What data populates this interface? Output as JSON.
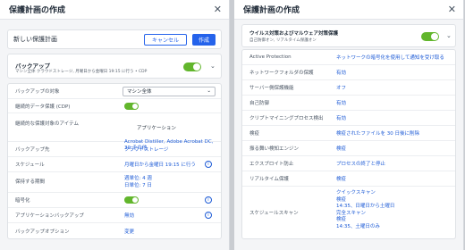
{
  "left": {
    "title": "保護計画の作成",
    "plan_name": "新しい保護計画",
    "cancel_label": "キャンセル",
    "create_label": "作成",
    "backup": {
      "title": "バックアップ",
      "desc": "マシン全体 クラウドストレージ, 月曜日から金曜日 19:15 に行う • CDP"
    },
    "rows": [
      {
        "label": "バックアップの対象",
        "value": "マシン全体",
        "kind": "select"
      },
      {
        "label": "継続的データ保護 (CDP)",
        "value": "",
        "kind": "toggle"
      },
      {
        "label": "継続的な保護対象のアイテム",
        "value": "アプリケーション\nAcrobat Distiller, Adobe Acrobat DC, 39 その他",
        "kind": "link-multi"
      },
      {
        "label": "バックアップ先",
        "value": "クラウドストレージ",
        "kind": "link"
      },
      {
        "label": "スケジュール",
        "value": "月曜日から金曜日 19:15 に行う",
        "kind": "link-info"
      },
      {
        "label": "保持する期間",
        "value": "週単位: 4 週\n日単位: 7 日",
        "kind": "link-multi"
      },
      {
        "label": "暗号化",
        "value": "",
        "kind": "toggle-info"
      },
      {
        "label": "アプリケーションバックアップ",
        "value": "無効",
        "kind": "link-info"
      },
      {
        "label": "バックアップオプション",
        "value": "変更",
        "kind": "link"
      }
    ]
  },
  "right": {
    "title": "保護計画の作成",
    "antivirus": {
      "title": "ウイルス対策およびマルウェア対策保護",
      "desc": "自己防御オン, リアルタイム保護オン"
    },
    "rows": [
      {
        "label": "Active Protection",
        "value": "ネットワークの暗号化を使用して通知を受け取る"
      },
      {
        "label": "ネットワークフォルダの保護",
        "value": "有効"
      },
      {
        "label": "サーバー側保護機能",
        "value": "オフ"
      },
      {
        "label": "自己防御",
        "value": "有効"
      },
      {
        "label": "クリプトマイニングプロセス検出",
        "value": "有効"
      },
      {
        "label": "検疫",
        "value": "検疫されたファイルを 30 日後に削除"
      },
      {
        "label": "振る舞い検知エンジン",
        "value": "検疫"
      },
      {
        "label": "エクスプロイト防止",
        "value": "プロセスの終了と停止"
      },
      {
        "label": "リアルタイム保護",
        "value": "検疫"
      },
      {
        "label": "スケジュールスキャン",
        "value": "クイックスキャン\n検疫\n14:35、日曜日から土曜日\n完全スキャン\n検疫\n14:35、土曜日のみ"
      }
    ]
  },
  "colors": {
    "accent": "#2563eb",
    "toggle_on": "#62b62c",
    "link": "#1d5bd6"
  }
}
